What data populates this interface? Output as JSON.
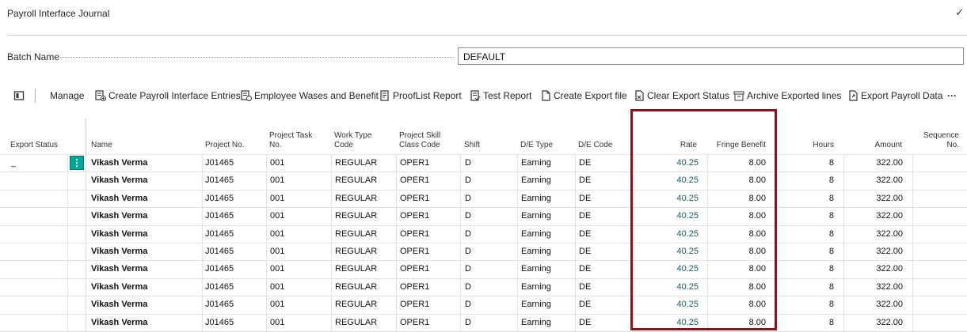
{
  "page": {
    "title": "Payroll Interface Journal",
    "check": "✓"
  },
  "batch": {
    "label": "Batch Name",
    "value": "DEFAULT"
  },
  "toolbar": {
    "items": [
      {
        "label": "",
        "icon": "page-icon"
      },
      {
        "label": "Manage",
        "icon": ""
      },
      {
        "label": "Create Payroll Interface Entries",
        "icon": "create-entries-icon"
      },
      {
        "label": "Employee Wases and Benefit",
        "icon": "employee-icon"
      },
      {
        "label": "ProofList Report",
        "icon": "report-icon"
      },
      {
        "label": "Test Report",
        "icon": "test-report-icon"
      },
      {
        "label": "Create Export file",
        "icon": "file-icon"
      },
      {
        "label": "Clear Export Status",
        "icon": "clear-icon"
      },
      {
        "label": "Archive Exported lines",
        "icon": "archive-icon"
      },
      {
        "label": "Export Payroll Data",
        "icon": "export-icon"
      },
      {
        "label": "···",
        "icon": ""
      }
    ]
  },
  "table": {
    "headers": {
      "export_status": "Export Status",
      "name": "Name",
      "project_no": "Project No.",
      "project_task_no_1": "Project Task",
      "project_task_no_2": "No.",
      "work_type_1": "Work Type",
      "work_type_2": "Code",
      "skill_1": "Project Skill",
      "skill_2": "Class Code",
      "shift": "Shift",
      "de_type": "D/E Type",
      "de_code": "D/E Code",
      "rate": "Rate",
      "fringe": "Fringe Benefit",
      "hours": "Hours",
      "amount": "Amount",
      "sequence_1": "Sequence",
      "sequence_2": "No."
    },
    "first_status": "_",
    "row_menu": "⋮",
    "rows": [
      {
        "name": "Vikash Verma",
        "project": "J01465",
        "task": "001",
        "work": "REGULAR",
        "skill": "OPER1",
        "shift": "D",
        "type": "Earning",
        "code": "DE",
        "rate": "40.25",
        "fringe": "8.00",
        "hours": "8",
        "amount": "322.00"
      },
      {
        "name": "Vikash Verma",
        "project": "J01465",
        "task": "001",
        "work": "REGULAR",
        "skill": "OPER1",
        "shift": "D",
        "type": "Earning",
        "code": "DE",
        "rate": "40.25",
        "fringe": "8.00",
        "hours": "8",
        "amount": "322.00"
      },
      {
        "name": "Vikash Verma",
        "project": "J01465",
        "task": "001",
        "work": "REGULAR",
        "skill": "OPER1",
        "shift": "D",
        "type": "Earning",
        "code": "DE",
        "rate": "40.25",
        "fringe": "8.00",
        "hours": "8",
        "amount": "322.00"
      },
      {
        "name": "Vikash Verma",
        "project": "J01465",
        "task": "001",
        "work": "REGULAR",
        "skill": "OPER1",
        "shift": "D",
        "type": "Earning",
        "code": "DE",
        "rate": "40.25",
        "fringe": "8.00",
        "hours": "8",
        "amount": "322.00"
      },
      {
        "name": "Vikash Verma",
        "project": "J01465",
        "task": "001",
        "work": "REGULAR",
        "skill": "OPER1",
        "shift": "D",
        "type": "Earning",
        "code": "DE",
        "rate": "40.25",
        "fringe": "8.00",
        "hours": "8",
        "amount": "322.00"
      },
      {
        "name": "Vikash Verma",
        "project": "J01465",
        "task": "001",
        "work": "REGULAR",
        "skill": "OPER1",
        "shift": "D",
        "type": "Earning",
        "code": "DE",
        "rate": "40.25",
        "fringe": "8.00",
        "hours": "8",
        "amount": "322.00"
      },
      {
        "name": "Vikash Verma",
        "project": "J01465",
        "task": "001",
        "work": "REGULAR",
        "skill": "OPER1",
        "shift": "D",
        "type": "Earning",
        "code": "DE",
        "rate": "40.25",
        "fringe": "8.00",
        "hours": "8",
        "amount": "322.00"
      },
      {
        "name": "Vikash Verma",
        "project": "J01465",
        "task": "001",
        "work": "REGULAR",
        "skill": "OPER1",
        "shift": "D",
        "type": "Earning",
        "code": "DE",
        "rate": "40.25",
        "fringe": "8.00",
        "hours": "8",
        "amount": "322.00"
      },
      {
        "name": "Vikash Verma",
        "project": "J01465",
        "task": "001",
        "work": "REGULAR",
        "skill": "OPER1",
        "shift": "D",
        "type": "Earning",
        "code": "DE",
        "rate": "40.25",
        "fringe": "8.00",
        "hours": "8",
        "amount": "322.00"
      },
      {
        "name": "Vikash Verma",
        "project": "J01465",
        "task": "001",
        "work": "REGULAR",
        "skill": "OPER1",
        "shift": "D",
        "type": "Earning",
        "code": "DE",
        "rate": "40.25",
        "fringe": "8.00",
        "hours": "8",
        "amount": "322.00"
      }
    ]
  },
  "colors": {
    "accent": "#00a69c",
    "highlight": "#7a1a1e",
    "rate_text": "#1a5a66"
  }
}
